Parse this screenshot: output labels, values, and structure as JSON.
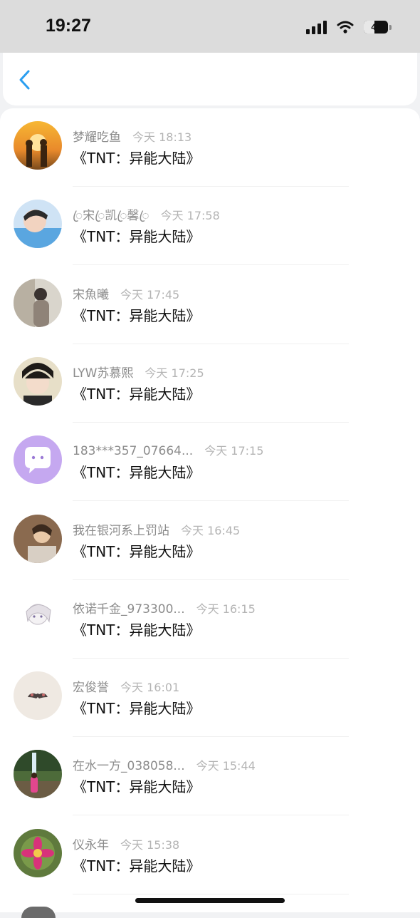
{
  "status_bar": {
    "time": "19:27",
    "battery": "44",
    "battery_level": 0.44
  },
  "nav": {
    "back_icon": "chevron-left-icon",
    "accent": "#2a9ef0"
  },
  "items": [
    {
      "name": "梦耀吃鱼",
      "time": "今天 18:13",
      "message": "《TNT：异能大陆》"
    },
    {
      "name": "ꦿ宋ꦿ凯ꦿ馨ꦿ",
      "time": "今天 17:58",
      "message": "《TNT：异能大陆》"
    },
    {
      "name": "宋魚曦",
      "time": "今天 17:45",
      "message": "《TNT：异能大陆》"
    },
    {
      "name": "LYW苏慕熙",
      "time": "今天 17:25",
      "message": "《TNT：异能大陆》"
    },
    {
      "name": "183***357_07664...",
      "time": "今天 17:15",
      "message": "《TNT：异能大陆》"
    },
    {
      "name": "我在银河系上罚站",
      "time": "今天 16:45",
      "message": "《TNT：异能大陆》"
    },
    {
      "name": "依诺千金_973300...",
      "time": "今天 16:15",
      "message": "《TNT：异能大陆》"
    },
    {
      "name": "宏俊誉",
      "time": "今天 16:01",
      "message": "《TNT：异能大陆》"
    },
    {
      "name": "在水一方_038058...",
      "time": "今天 15:44",
      "message": "《TNT：异能大陆》"
    },
    {
      "name": "仪永年",
      "time": "今天 15:38",
      "message": "《TNT：异能大陆》"
    }
  ]
}
